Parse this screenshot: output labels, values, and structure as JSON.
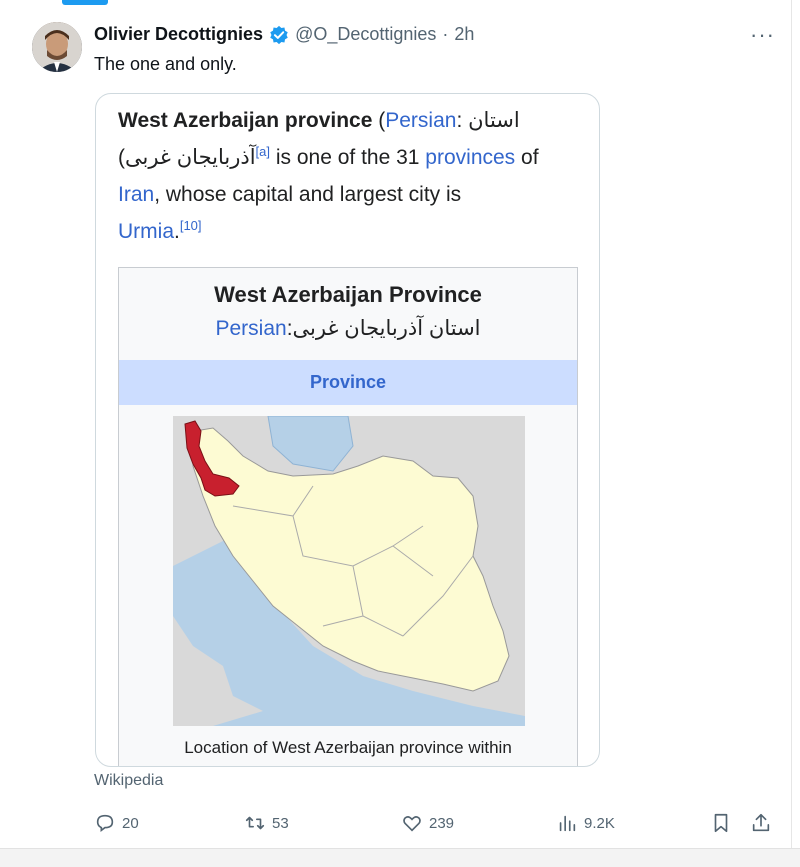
{
  "tweet": {
    "author_name": "Olivier Decottignies",
    "handle": "@O_Decottignies",
    "separator": "·",
    "time": "2h",
    "text": "The one and only.",
    "more_label": "···"
  },
  "card": {
    "article_intro": {
      "title_bold": "West Azerbaijan province",
      "open_paren": " (",
      "persian_link": "Persian",
      "persian_text": ": استان",
      "persian_text2": "(آذربایجان غربی",
      "ref_a": "[a]",
      "mid_text": " is one of the 31 ",
      "provinces_link": "provinces",
      "of_text": " of",
      "iran_link": "Iran",
      "capital_text": ", whose capital and largest city is",
      "urmia_link": "Urmia",
      "period": ".",
      "ref_10": "[10]"
    },
    "infobox": {
      "title": "West Azerbaijan Province",
      "persian_label": "Persian",
      "persian_name": ":استان آذربایجان غربی",
      "type": "Province",
      "caption": "Location of West Azerbaijan province within"
    },
    "source": "Wikipedia"
  },
  "actions": {
    "replies": "20",
    "reposts": "53",
    "likes": "239",
    "views": "9.2K"
  },
  "colors": {
    "link": "#3366cc",
    "verified": "#1d9bf0",
    "highlight_province": "#c8202e",
    "iran_fill": "#fdfbd3",
    "water": "#b5d0e7",
    "neighbors": "#d9d9d9"
  },
  "icons": [
    "verified-badge-icon",
    "more-icon",
    "reply-icon",
    "repost-icon",
    "like-icon",
    "views-icon",
    "bookmark-icon",
    "share-icon"
  ]
}
